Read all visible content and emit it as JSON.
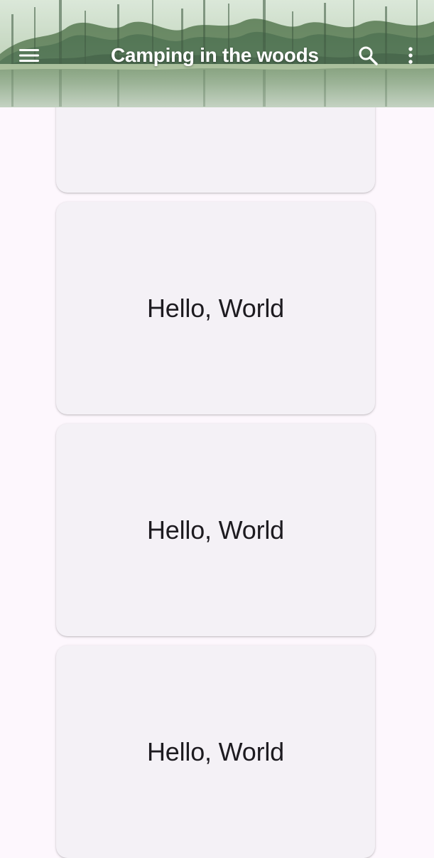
{
  "app_bar": {
    "title": "Camping in the woods",
    "background_image": "forest-lake",
    "menu_icon": "menu-icon",
    "search_icon": "search-icon",
    "more_icon": "more-vert-icon"
  },
  "cards": [
    {
      "text": ""
    },
    {
      "text": "Hello, World"
    },
    {
      "text": "Hello, World"
    },
    {
      "text": "Hello, World"
    }
  ],
  "colors": {
    "background": "#fdf7fd",
    "card": "#f4f1f6",
    "text": "#1d1b20",
    "app_bar_text": "#ffffff"
  }
}
